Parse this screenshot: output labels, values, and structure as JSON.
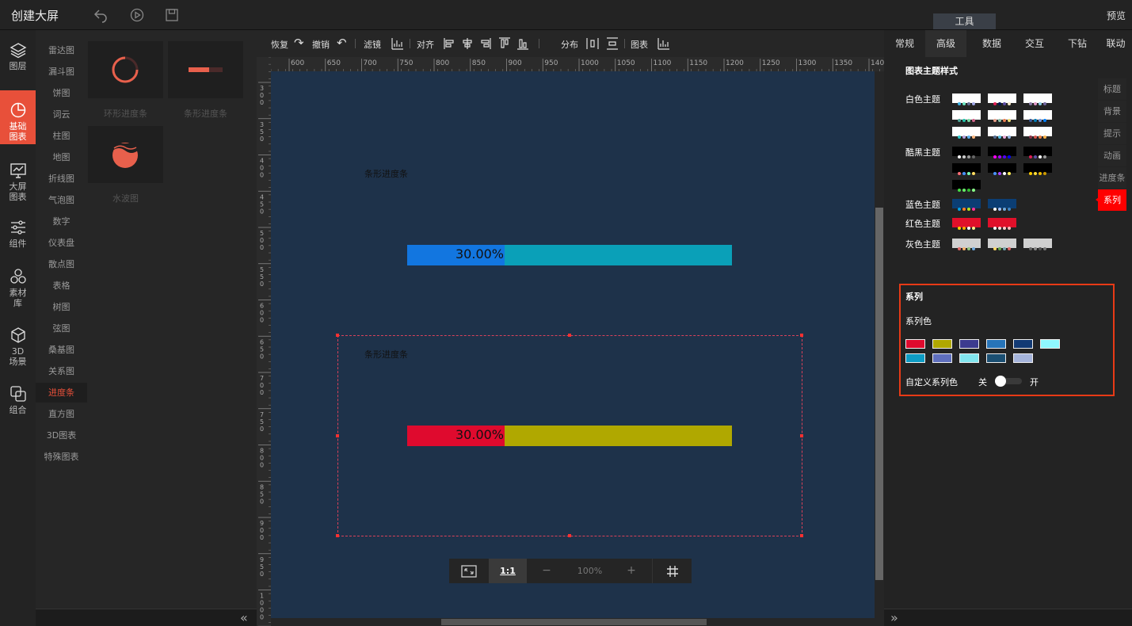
{
  "app": {
    "title": "创建大屏",
    "preview": "预览",
    "tools_tab": "工具"
  },
  "leftnav": [
    {
      "label": "图层",
      "icon": "layers-icon"
    },
    {
      "label": "基础图表",
      "icon": "pie-chart-icon",
      "active": true
    },
    {
      "label": "大屏图表",
      "icon": "monitor-chart-icon"
    },
    {
      "label": "组件",
      "icon": "sliders-icon"
    },
    {
      "label": "素材库",
      "icon": "cubes-icon"
    },
    {
      "label": "3D场景",
      "icon": "cube-3d-icon"
    },
    {
      "label": "组合",
      "icon": "combine-icon"
    }
  ],
  "categories": [
    "雷达图",
    "漏斗图",
    "饼图",
    "词云",
    "柱图",
    "地图",
    "折线图",
    "气泡图",
    "数字",
    "仪表盘",
    "散点图",
    "表格",
    "树图",
    "弦图",
    "桑基图",
    "关系图",
    "进度条",
    "直方图",
    "3D图表",
    "特殊图表"
  ],
  "active_category": "进度条",
  "gallery": [
    {
      "label": "环形进度条",
      "icon": "ring-progress-icon"
    },
    {
      "label": "条形进度条",
      "icon": "bar-progress-icon"
    },
    {
      "label": "水波图",
      "icon": "liquid-fill-icon"
    }
  ],
  "toolbar": {
    "redo": "恢复",
    "undo": "撤销",
    "filter": "滤镜",
    "align": "对齐",
    "distribute": "分布",
    "chart": "图表"
  },
  "ruler_h": [
    "600",
    "650",
    "700",
    "750",
    "800",
    "850",
    "900",
    "950",
    "1000",
    "1050",
    "1100",
    "1150",
    "1200",
    "1250",
    "1300",
    "1350",
    "1400"
  ],
  "ruler_v": [
    "300",
    "350",
    "400",
    "450",
    "500",
    "550",
    "600",
    "650",
    "700",
    "750",
    "800",
    "850",
    "900",
    "950",
    "1000",
    "1050"
  ],
  "canvas": {
    "widgets": [
      {
        "title": "条形进度条",
        "percent_text": "30.00%",
        "progress": 0.3,
        "fill_color": "#1276e0",
        "track_color": "#0aa0b8"
      },
      {
        "title": "条形进度条",
        "percent_text": "30.00%",
        "progress": 0.3,
        "fill_color": "#df0a2e",
        "track_color": "#b0a800"
      }
    ]
  },
  "zoom": {
    "fit": "fit-screen-icon",
    "one_to_one": "1:1",
    "minus": "−",
    "level": "100%",
    "plus": "+",
    "grid": "grid-icon"
  },
  "rpanel": {
    "tabs": [
      "常规",
      "高级",
      "数据",
      "交互",
      "下钻",
      "联动"
    ],
    "active_tab": "高级",
    "theme_section_title": "图表主题样式",
    "themes": [
      {
        "label": "白色主题",
        "bg": "#ffffff",
        "swatches": [
          [
            "#3fb1e3",
            "#6be6c1",
            "#626c91",
            "#a0a7e6"
          ],
          [
            "#e01f54",
            "#001852",
            "#5e4ea5",
            "#f5e8c8"
          ],
          [
            "#8a7ca8",
            "#e098c7",
            "#8fd3e8",
            "#71669e"
          ],
          [
            "#4ea397",
            "#22c3aa",
            "#7bd9a5",
            "#d0648a"
          ],
          [
            "#e69d87",
            "#8dc1a9",
            "#ea7e53",
            "#eedd78"
          ],
          [
            "#3a5897",
            "#007bb6",
            "#7094db",
            "#0080ff"
          ],
          [
            "#2ec7c9",
            "#b6a2de",
            "#5ab1ef",
            "#ffb980"
          ],
          [
            "#516b91",
            "#59c4e6",
            "#edafda",
            "#93b7e3"
          ],
          [
            "#893448",
            "#d95850",
            "#eb8146",
            "#ffb248"
          ]
        ]
      },
      {
        "label": "酷黑主题",
        "bg": "#000000",
        "swatches": [
          [
            "#ffffff",
            "#cccccc",
            "#999999",
            "#666666"
          ],
          [
            "#ff00ff",
            "#aa00ff",
            "#5500ff",
            "#0000ff"
          ],
          [
            "#e01f54",
            "#5e4ea5",
            "#ffffff",
            "#999999"
          ],
          [
            "#ff6e76",
            "#4992ff",
            "#7cffb2",
            "#fddd60"
          ],
          [
            "#4992ff",
            "#aa44ff",
            "#ffffff",
            "#ffee55"
          ],
          [
            "#ffcc00",
            "#ffdd33",
            "#eebb00",
            "#cc9900"
          ],
          [
            "#44dd44",
            "#66ee66",
            "#33bb33",
            "#88ff88"
          ]
        ]
      },
      {
        "label": "蓝色主题",
        "bg": "#0b3e74",
        "swatches": [
          [
            "#00a2e8",
            "#ff7f27",
            "#b5e61d",
            "#ff3399"
          ],
          [
            "#ffffff",
            "#a0c4ff",
            "#6fa8dc",
            "#3d85c6"
          ]
        ]
      },
      {
        "label": "红色主题",
        "bg": "#e0102a",
        "swatches": [
          [
            "#ffd500",
            "#ffaa00",
            "#ffffff",
            "#ffee88"
          ],
          [
            "#ffffff",
            "#ffdddd",
            "#ffcccc",
            "#ffbbbb"
          ]
        ]
      },
      {
        "label": "灰色主题",
        "bg": "#d0d0d0",
        "swatches": [
          [
            "#e06666",
            "#f6b26b",
            "#93c47d",
            "#6fa8dc"
          ],
          [
            "#ffd966",
            "#6aa84f",
            "#76a5af",
            "#e06666"
          ],
          [
            "#666666",
            "#888888",
            "#555555",
            "#777777"
          ]
        ]
      }
    ],
    "side_tabs": [
      "标题",
      "背景",
      "提示",
      "动画",
      "进度条",
      "系列"
    ],
    "active_side_tab": "系列",
    "series": {
      "title": "系列",
      "color_label": "系列色",
      "colors": [
        "#df0a2e",
        "#b0a800",
        "#3c3b8f",
        "#2774b8",
        "#123a74",
        "#8ff8ff",
        "#0e9cc4",
        "#5f6fbd",
        "#82e6ef",
        "#1b4f72",
        "#a5b4db"
      ],
      "custom_label": "自定义系列色",
      "off": "关",
      "on": "开",
      "custom_enabled": false
    }
  }
}
